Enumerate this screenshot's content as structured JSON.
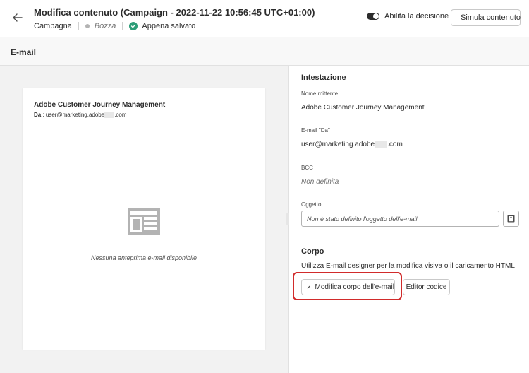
{
  "header": {
    "back_icon": "arrow-left-icon",
    "title": "Modifica contenuto (Campaign - 2022-11-22 10:56:45 UTC+01:00)",
    "type": "Campagna",
    "status": "Bozza",
    "saved": "Appena salvato",
    "toggle_label": "Abilita la decisione",
    "toggle_on": true,
    "simulate_label": "Simula contenuto"
  },
  "section": {
    "title": "E-mail"
  },
  "preview": {
    "sender": "Adobe Customer Journey Management",
    "from_label": "Da",
    "from_value_prefix": "user@marketing.adobe",
    "from_value_suffix": ".com",
    "empty_text": "Nessuna anteprima e-mail disponibile"
  },
  "settings": {
    "header_title": "Intestazione",
    "sender_name_label": "Nome mittente",
    "sender_name_value": "Adobe Customer Journey Management",
    "from_label": "E-mail \"Da\"",
    "from_value_prefix": "user@marketing.adobe",
    "from_value_suffix": ".com",
    "bcc_label": "BCC",
    "bcc_value": "Non definita",
    "subject_label": "Oggetto",
    "subject_placeholder": "Non è stato definito l'oggetto dell'e-mail",
    "body_title": "Corpo",
    "body_description": "Utilizza E-mail designer per la modifica visiva o il caricamento HTML",
    "edit_body_label": "Modifica corpo dell'e-mail",
    "code_editor_label": "Editor codice"
  },
  "colors": {
    "highlight": "#d12b2b",
    "saved_check": "#2d9d78"
  }
}
